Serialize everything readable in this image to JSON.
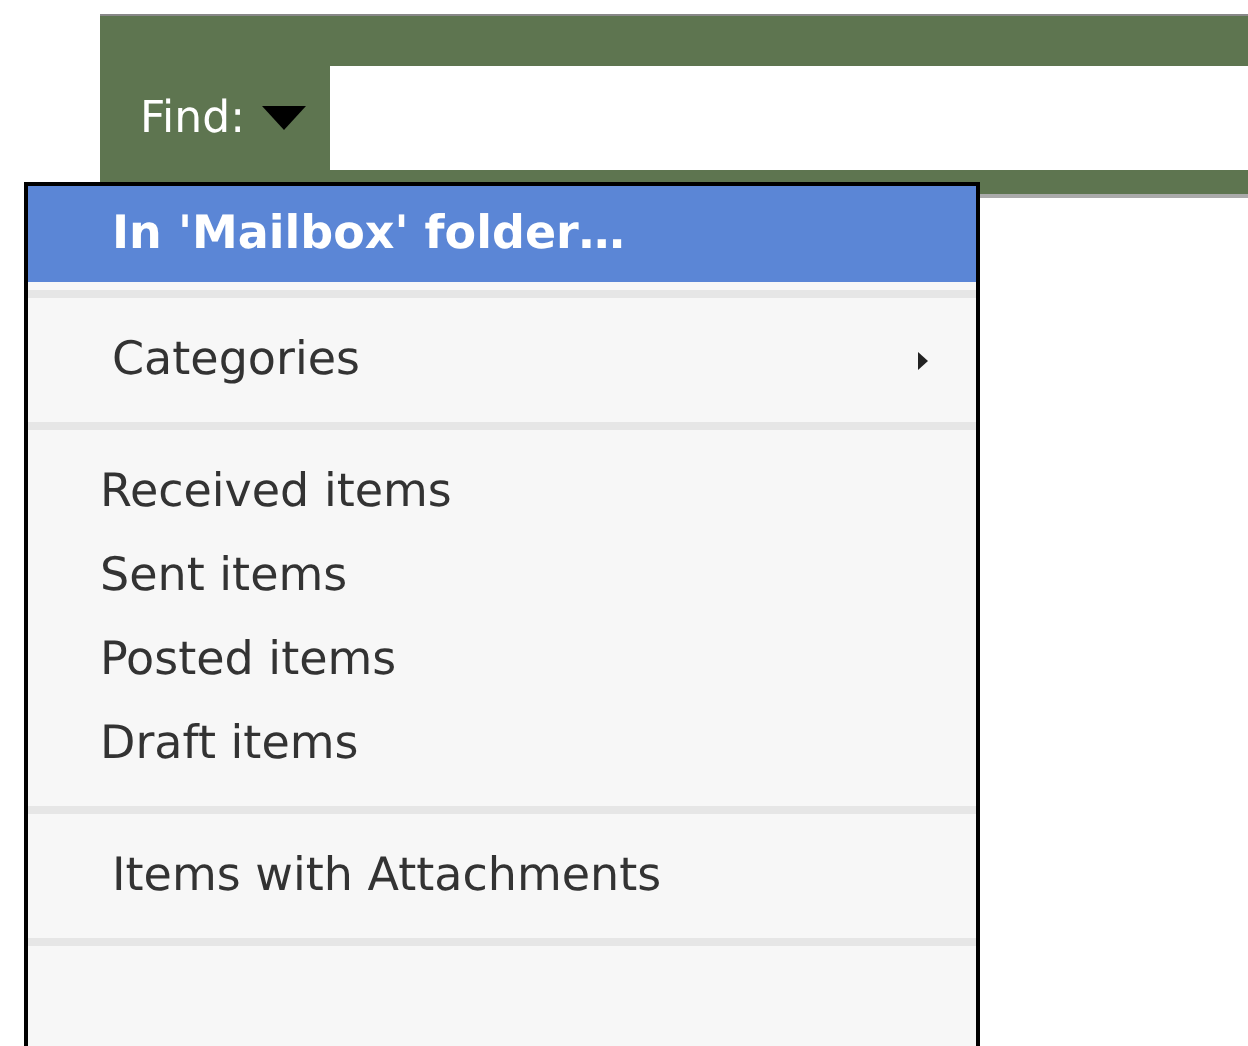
{
  "find_bar": {
    "label": "Find:"
  },
  "menu": {
    "sections": [
      {
        "items": [
          {
            "label": "In 'Mailbox' folder…",
            "selected": true,
            "kind": "plain"
          }
        ]
      },
      {
        "items": [
          {
            "label": "Categories",
            "selected": false,
            "kind": "submenu"
          }
        ]
      },
      {
        "items": [
          {
            "label": "Received items",
            "selected": false,
            "kind": "plain"
          },
          {
            "label": "Sent items",
            "selected": false,
            "kind": "plain"
          },
          {
            "label": "Posted items",
            "selected": false,
            "kind": "plain"
          },
          {
            "label": "Draft items",
            "selected": false,
            "kind": "plain"
          }
        ]
      },
      {
        "items": [
          {
            "label": "Items with Attachments",
            "selected": false,
            "kind": "plain"
          }
        ]
      }
    ]
  }
}
